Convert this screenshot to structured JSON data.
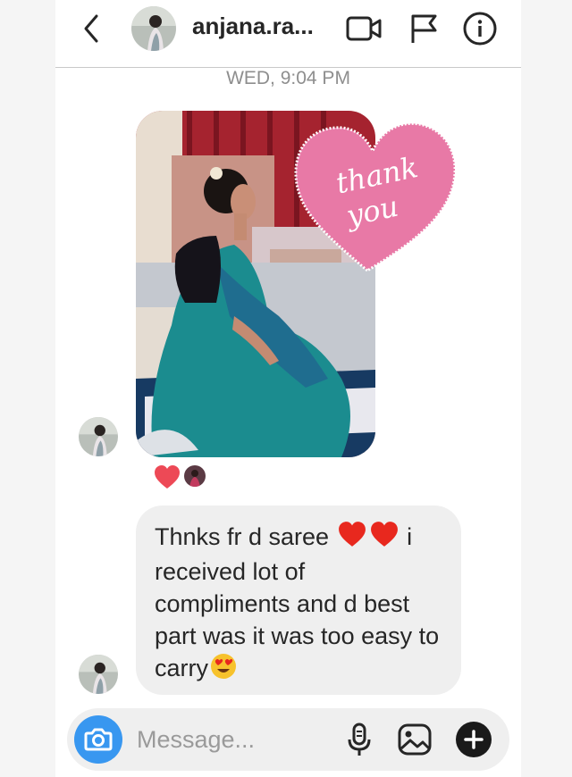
{
  "header": {
    "username": "anjana.ra...",
    "back_icon": "chevron-left-icon",
    "video_icon": "video-call-icon",
    "flag_icon": "flag-icon",
    "info_icon": "info-icon"
  },
  "thread": {
    "timestamp": "WED, 9:04 PM",
    "photo_sticker_text": "thank you",
    "reactions": [
      "red-heart",
      "avatar"
    ],
    "message": {
      "text_before": "Thnks fr d saree",
      "emoji_1": "❤️",
      "emoji_2": "❤️",
      "text_after": "i received lot of compliments and d best part was it was too easy to carry",
      "emoji_end": "😍"
    }
  },
  "composer": {
    "placeholder": "Message...",
    "camera_icon": "camera-icon",
    "mic_icon": "microphone-icon",
    "gallery_icon": "gallery-icon",
    "plus_icon": "plus-icon"
  },
  "colors": {
    "accent_blue": "#3897f0",
    "bubble_bg": "#efefef",
    "sticker_pink": "#e879a6",
    "heart_red": "#ed4956"
  }
}
